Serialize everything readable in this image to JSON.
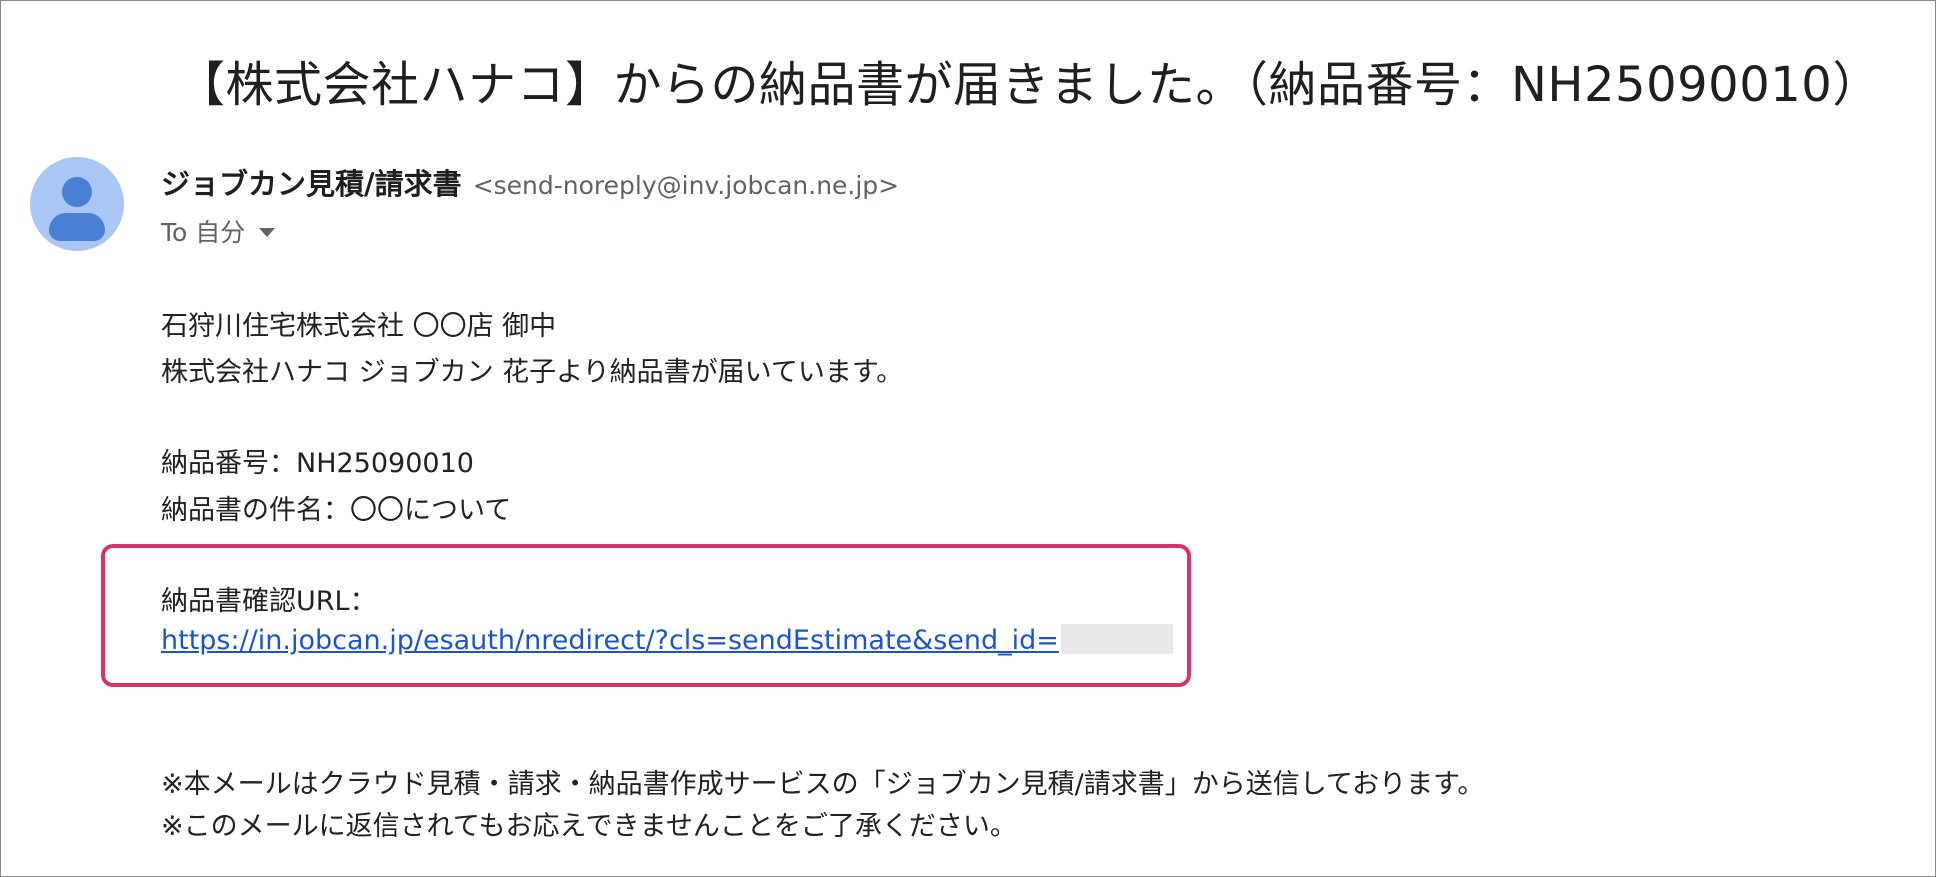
{
  "email": {
    "subject": "【株式会社ハナコ】からの納品書が届きました。（納品番号：NH25090010）",
    "sender": {
      "name": "ジョブカン見積/請求書",
      "email": "<send-noreply@inv.jobcan.ne.jp>",
      "avatar_icon": "person-icon"
    },
    "recipient": {
      "label": "To 自分"
    },
    "body": {
      "addressee": "石狩川住宅株式会社 〇〇店 御中",
      "intro": "株式会社ハナコ ジョブカン 花子より納品書が届いています。",
      "delivery_number": "納品番号：NH25090010",
      "delivery_subject": "納品書の件名：〇〇について",
      "url_label": "納品書確認URL：",
      "url": "https://in.jobcan.jp/esauth/nredirect/?cls=sendEstimate&send_id=",
      "note_1": "※本メールはクラウド見積・請求・納品書作成サービスの「ジョブカン見積/請求書」から送信しております。",
      "note_2": "※このメールに返信されてもお応えできませんことをご了承ください。"
    },
    "highlight_color": "#d6336c",
    "link_color": "#1a56c9"
  }
}
